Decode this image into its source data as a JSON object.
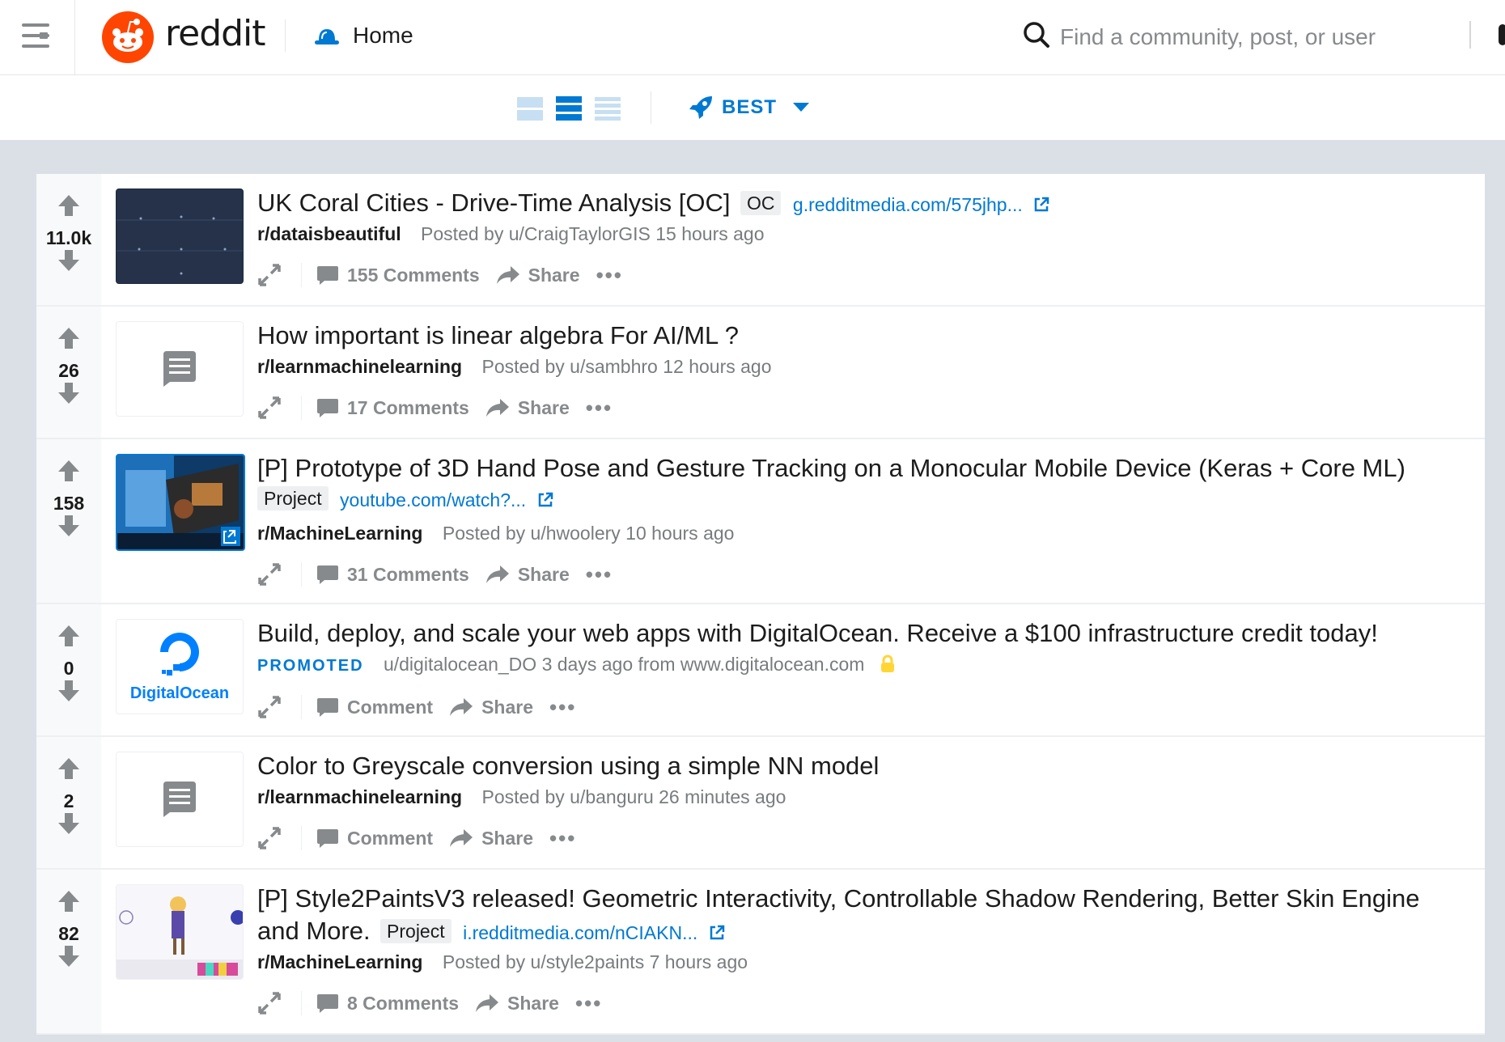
{
  "header": {
    "brand": "reddit",
    "home_label": "Home",
    "search_placeholder": "Find a community, post, or user"
  },
  "sort": {
    "label": "BEST",
    "layout_selected": "classic"
  },
  "colors": {
    "accent": "#0079d3",
    "brand": "#ff4500",
    "muted": "#878a8c"
  },
  "posts": [
    {
      "score": "11.0k",
      "title": "UK Coral Cities - Drive-Time Analysis [OC]",
      "flair": "OC",
      "domain": "g.redditmedia.com/575jhp...",
      "subreddit": "r/dataisbeautiful",
      "posted": "Posted by u/CraigTaylorGIS 15 hours ago",
      "comments": "155 Comments",
      "share": "Share",
      "thumb": "map-image"
    },
    {
      "score": "26",
      "title": "How important is linear algebra For AI/ML ?",
      "subreddit": "r/learnmachinelearning",
      "posted": "Posted by u/sambhro 12 hours ago",
      "comments": "17 Comments",
      "share": "Share",
      "thumb": "text-post-icon"
    },
    {
      "score": "158",
      "title": "[P] Prototype of 3D Hand Pose and Gesture Tracking on a Monocular Mobile Device (Keras + Core ML)",
      "flair": "Project",
      "domain": "youtube.com/watch?...",
      "subreddit": "r/MachineLearning",
      "posted": "Posted by u/hwoolery 10 hours ago",
      "comments": "31 Comments",
      "share": "Share",
      "thumb": "video-image"
    },
    {
      "score": "0",
      "title": "Build, deploy, and scale your web apps with DigitalOcean. Receive a $100 infrastructure credit today!",
      "promoted": "PROMOTED",
      "posted": "u/digitalocean_DO 3 days ago from www.digitalocean.com",
      "comments": "Comment",
      "share": "Share",
      "thumb_text": "DigitalOcean"
    },
    {
      "score": "2",
      "title": "Color to Greyscale conversion using a simple NN model",
      "subreddit": "r/learnmachinelearning",
      "posted": "Posted by u/banguru 26 minutes ago",
      "comments": "Comment",
      "share": "Share",
      "thumb": "text-post-icon"
    },
    {
      "score": "82",
      "title": "[P] Style2PaintsV3 released! Geometric Interactivity, Controllable Shadow Rendering, Better Skin Engine and More.",
      "flair": "Project",
      "domain": "i.redditmedia.com/nCIAKN...",
      "subreddit": "r/MachineLearning",
      "posted": "Posted by u/style2paints 7 hours ago",
      "comments": "8 Comments",
      "share": "Share",
      "thumb": "illustration-image"
    }
  ]
}
